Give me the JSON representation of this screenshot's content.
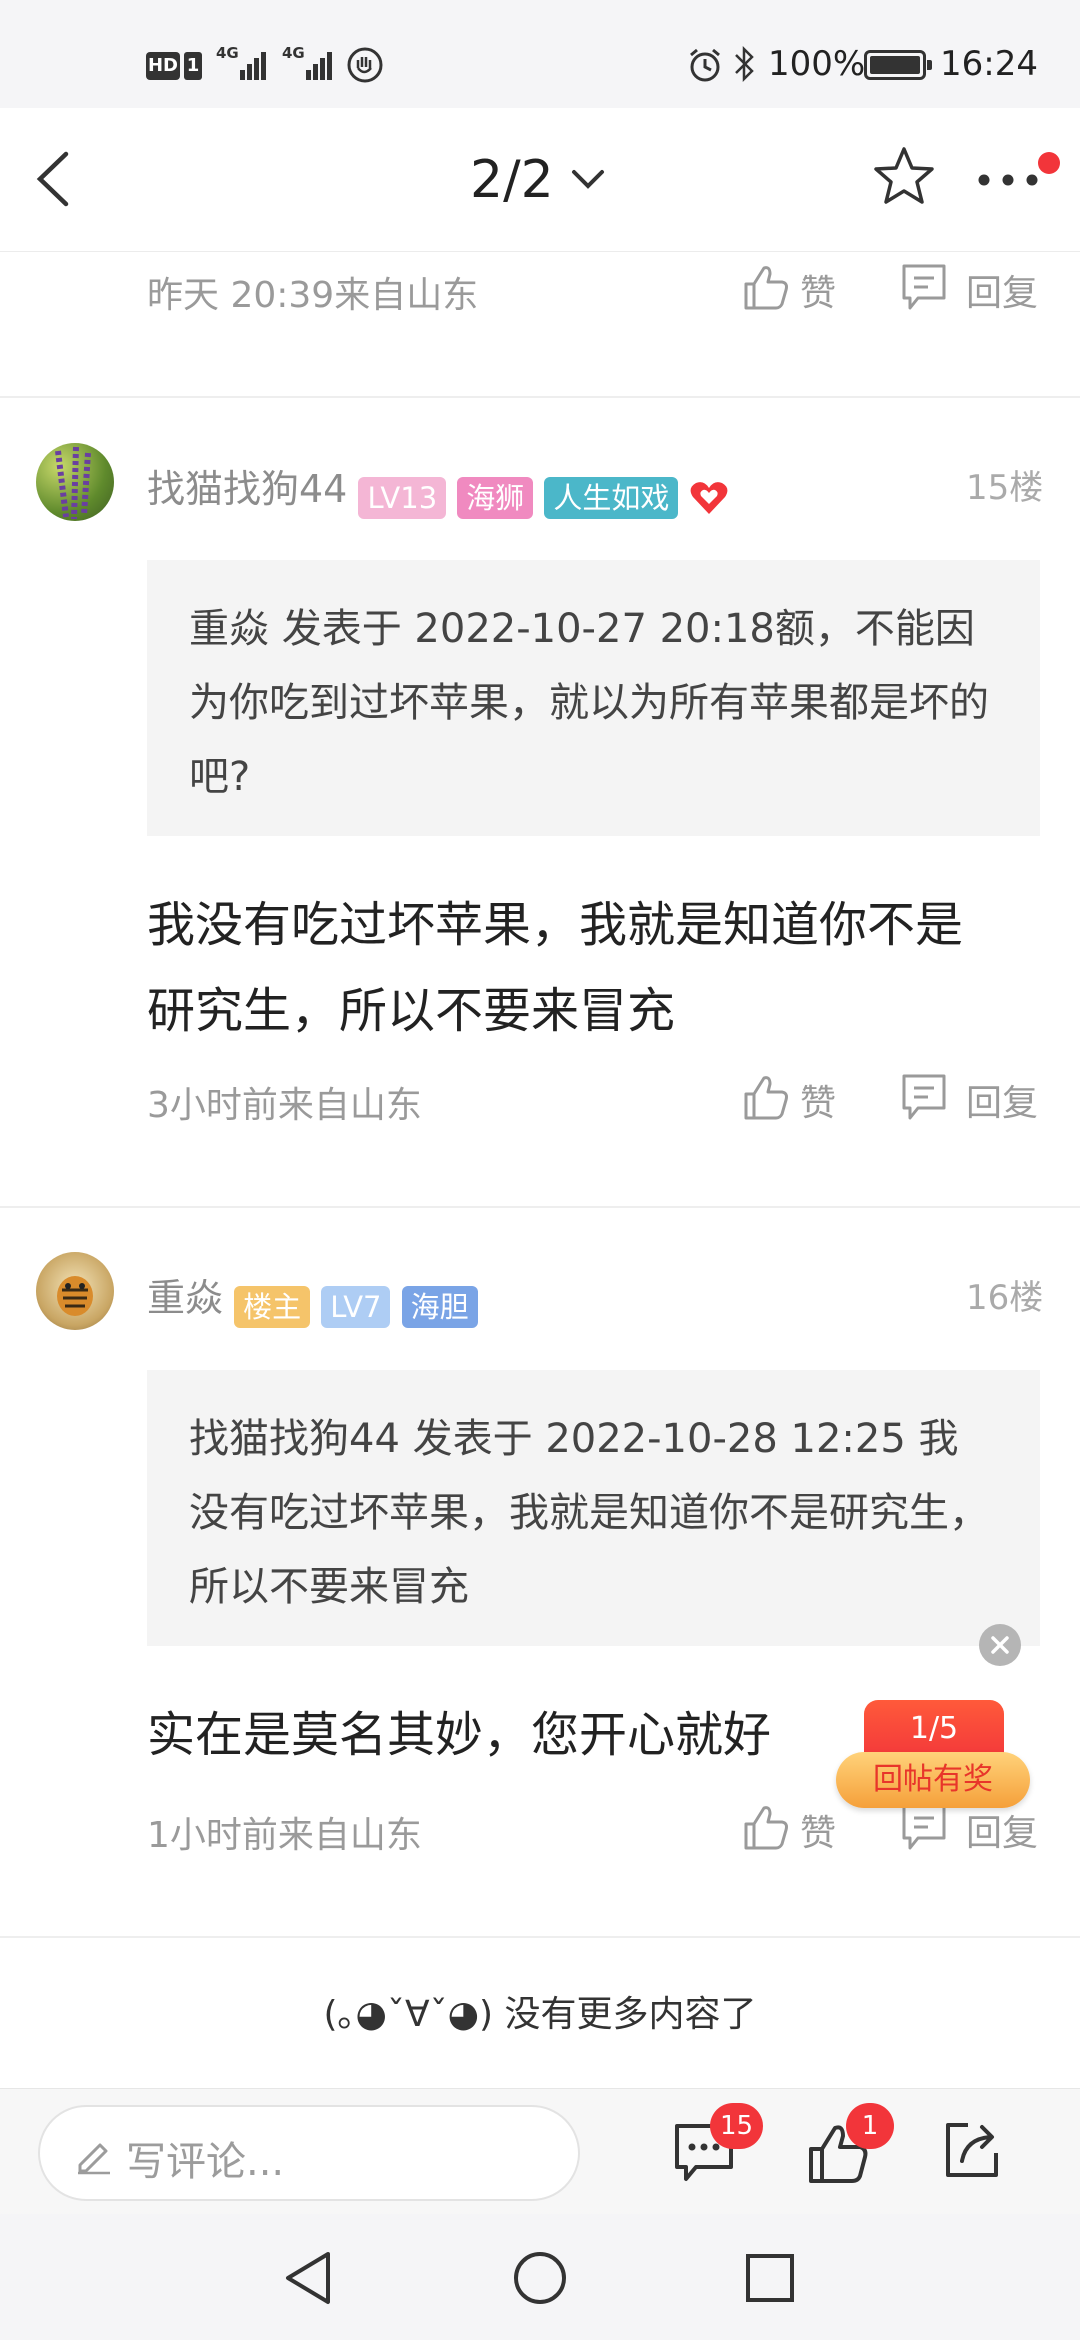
{
  "status_bar": {
    "hd": "HD",
    "sim": "1",
    "net1": "4G",
    "net2": "4G",
    "battery_percent": "100%",
    "time": "16:24"
  },
  "nav": {
    "page": "2/2"
  },
  "prev_post": {
    "meta": "昨天 20:39来自山东",
    "like_label": "赞",
    "reply_label": "回复"
  },
  "posts": [
    {
      "username": "找猫找狗44",
      "badges": [
        {
          "text": "LV13",
          "color": "#f4b6d5"
        },
        {
          "text": "海狮",
          "color": "#f08ac0"
        },
        {
          "text": "人生如戏",
          "color": "#4bb7c9"
        }
      ],
      "floor": "15楼",
      "quote": "重焱 发表于 2022-10-27 20:18额，不能因为你吃到过坏苹果，就以为所有苹果都是坏的吧?",
      "content": "我没有吃过坏苹果，我就是知道你不是研究生，所以不要来冒充",
      "meta": "3小时前来自山东",
      "like_label": "赞",
      "reply_label": "回复"
    },
    {
      "username": "重焱",
      "badges": [
        {
          "text": "楼主",
          "color": "#f5c46a"
        },
        {
          "text": "LV7",
          "color": "#aecdf4"
        },
        {
          "text": "海胆",
          "color": "#7aa4e6"
        }
      ],
      "floor": "16楼",
      "quote": "找猫找狗44 发表于 2022-10-28 12:25 我没有吃过坏苹果，我就是知道你不是研究生，所以不要来冒充",
      "content": "实在是莫名其妙，您开心就好",
      "meta": "1小时前来自山东",
      "like_label": "赞",
      "reply_label": "回复"
    }
  ],
  "reward": {
    "count": "1/5",
    "label": "回帖有奖"
  },
  "end_text": "(｡◕ˇ∀ˇ◕) 没有更多内容了",
  "bottom_bar": {
    "placeholder": "写评论...",
    "comment_count": "15",
    "like_count": "1"
  },
  "colors": {
    "accent_red": "#f2353a",
    "reward_orange": "#f5a03a"
  }
}
